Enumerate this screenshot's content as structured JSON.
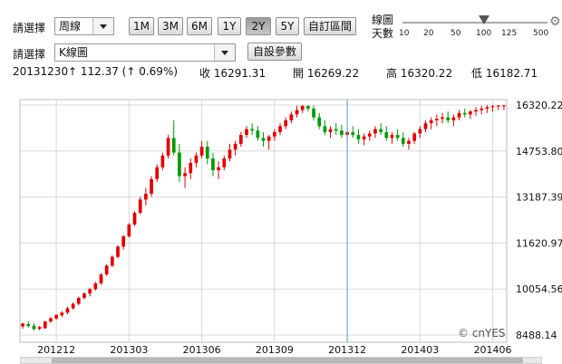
{
  "controls": {
    "period_label": "請選擇",
    "period_value": "周線",
    "range_buttons": [
      "1M",
      "3M",
      "6M",
      "1Y",
      "2Y",
      "5Y"
    ],
    "active_range": "2Y",
    "custom_range_label": "自訂區間",
    "zoom_label_1": "線圖",
    "zoom_label_2": "天數",
    "zoom_ticks": [
      "10",
      "20",
      "50",
      "100",
      "125",
      "500"
    ],
    "zoom_value": "100",
    "chart_type_label": "請選擇",
    "chart_type_value": "K線圖",
    "custom_params_label": "自設參數"
  },
  "info": {
    "date": "20131230",
    "change": "↑ 112.37 (↑ 0.69%)",
    "close": "收 16291.31",
    "open": "開 16269.22",
    "high": "高 16320.22",
    "low": "低 16182.71"
  },
  "watermark": "© cnYES",
  "colors": {
    "up": "#e00000",
    "down": "#009900",
    "crosshair": "#5aa0d8",
    "grid": "#d8d8d8"
  },
  "chart_data": {
    "type": "candlestick",
    "ylim": [
      8488.14,
      16320.22
    ],
    "y_ticks": [
      "16320.22",
      "14753.80",
      "13187.39",
      "11620.97",
      "10054.56",
      "8488.14"
    ],
    "x_ticks": [
      "201212",
      "201303",
      "201306",
      "201309",
      "201312",
      "201403",
      "201406"
    ],
    "x_tick_index": [
      6,
      19,
      32,
      45,
      58,
      71,
      84
    ],
    "crosshair_index": 58,
    "candles": [
      [
        8780,
        8900,
        8700,
        8880
      ],
      [
        8860,
        8950,
        8750,
        8790
      ],
      [
        8800,
        8880,
        8650,
        8690
      ],
      [
        8700,
        8800,
        8650,
        8760
      ],
      [
        8720,
        8970,
        8700,
        8950
      ],
      [
        8950,
        9100,
        8900,
        9060
      ],
      [
        9050,
        9200,
        9000,
        9170
      ],
      [
        9160,
        9300,
        9100,
        9250
      ],
      [
        9250,
        9450,
        9200,
        9400
      ],
      [
        9400,
        9600,
        9350,
        9550
      ],
      [
        9550,
        9800,
        9500,
        9750
      ],
      [
        9750,
        9950,
        9700,
        9900
      ],
      [
        9900,
        10100,
        9800,
        10050
      ],
      [
        10050,
        10300,
        10000,
        10250
      ],
      [
        10250,
        10600,
        10200,
        10550
      ],
      [
        10550,
        10900,
        10500,
        10850
      ],
      [
        10850,
        11200,
        10800,
        11150
      ],
      [
        11150,
        11550,
        11100,
        11500
      ],
      [
        11500,
        11900,
        11400,
        11850
      ],
      [
        11850,
        12300,
        11800,
        12250
      ],
      [
        12250,
        12700,
        12200,
        12650
      ],
      [
        12650,
        13200,
        12600,
        13100
      ],
      [
        13100,
        13500,
        12900,
        13300
      ],
      [
        13300,
        13900,
        13200,
        13800
      ],
      [
        13800,
        14300,
        13700,
        14200
      ],
      [
        14200,
        14700,
        14100,
        14600
      ],
      [
        14600,
        15300,
        14500,
        15200
      ],
      [
        15200,
        15800,
        14600,
        14700
      ],
      [
        14700,
        15000,
        13700,
        13900
      ],
      [
        13900,
        14200,
        13500,
        14000
      ],
      [
        14000,
        14500,
        13800,
        14350
      ],
      [
        14350,
        14700,
        14200,
        14600
      ],
      [
        14600,
        15100,
        14500,
        14900
      ],
      [
        14900,
        15100,
        14300,
        14500
      ],
      [
        14500,
        14700,
        13900,
        14100
      ],
      [
        14100,
        14400,
        13800,
        14200
      ],
      [
        14200,
        14600,
        14100,
        14500
      ],
      [
        14500,
        15000,
        14400,
        14800
      ],
      [
        14800,
        15100,
        14600,
        15000
      ],
      [
        15000,
        15400,
        14900,
        15300
      ],
      [
        15300,
        15600,
        15200,
        15500
      ],
      [
        15500,
        15700,
        15300,
        15450
      ],
      [
        15450,
        15600,
        15100,
        15200
      ],
      [
        15200,
        15400,
        14900,
        15100
      ],
      [
        15100,
        15300,
        14800,
        15250
      ],
      [
        15250,
        15500,
        15100,
        15400
      ],
      [
        15400,
        15700,
        15300,
        15600
      ],
      [
        15600,
        15900,
        15500,
        15800
      ],
      [
        15800,
        16100,
        15700,
        16000
      ],
      [
        16000,
        16300,
        15900,
        16150
      ],
      [
        16150,
        16320,
        16050,
        16291
      ],
      [
        16290,
        16320,
        16100,
        16200
      ],
      [
        16200,
        16300,
        15800,
        15900
      ],
      [
        15900,
        16050,
        15500,
        15600
      ],
      [
        15600,
        15800,
        15300,
        15400
      ],
      [
        15400,
        15600,
        15200,
        15500
      ],
      [
        15500,
        15700,
        15300,
        15450
      ],
      [
        15450,
        15650,
        15200,
        15300
      ],
      [
        15300,
        15500,
        15100,
        15400
      ],
      [
        15400,
        15600,
        15200,
        15300
      ],
      [
        15300,
        15500,
        15000,
        15150
      ],
      [
        15150,
        15350,
        14950,
        15250
      ],
      [
        15250,
        15450,
        15100,
        15350
      ],
      [
        15350,
        15600,
        15200,
        15500
      ],
      [
        15500,
        15700,
        15300,
        15400
      ],
      [
        15400,
        15600,
        15100,
        15200
      ],
      [
        15200,
        15400,
        15000,
        15300
      ],
      [
        15300,
        15500,
        15100,
        15200
      ],
      [
        15200,
        15400,
        14900,
        15000
      ],
      [
        15000,
        15200,
        14800,
        15100
      ],
      [
        15100,
        15400,
        15000,
        15350
      ],
      [
        15350,
        15600,
        15200,
        15500
      ],
      [
        15500,
        15800,
        15400,
        15700
      ],
      [
        15700,
        15900,
        15500,
        15800
      ],
      [
        15800,
        16000,
        15600,
        15850
      ],
      [
        15850,
        16050,
        15700,
        15900
      ],
      [
        15900,
        16100,
        15700,
        15800
      ],
      [
        15800,
        16000,
        15600,
        15900
      ],
      [
        15900,
        16150,
        15800,
        16050
      ],
      [
        16050,
        16200,
        15900,
        16000
      ],
      [
        16000,
        16150,
        15850,
        16100
      ],
      [
        16100,
        16250,
        15950,
        16150
      ],
      [
        16150,
        16300,
        16000,
        16200
      ],
      [
        16200,
        16320,
        16050,
        16250
      ],
      [
        16250,
        16320,
        16100,
        16280
      ],
      [
        16280,
        16320,
        16150,
        16300
      ],
      [
        16300,
        16320,
        16150,
        16310
      ]
    ]
  }
}
